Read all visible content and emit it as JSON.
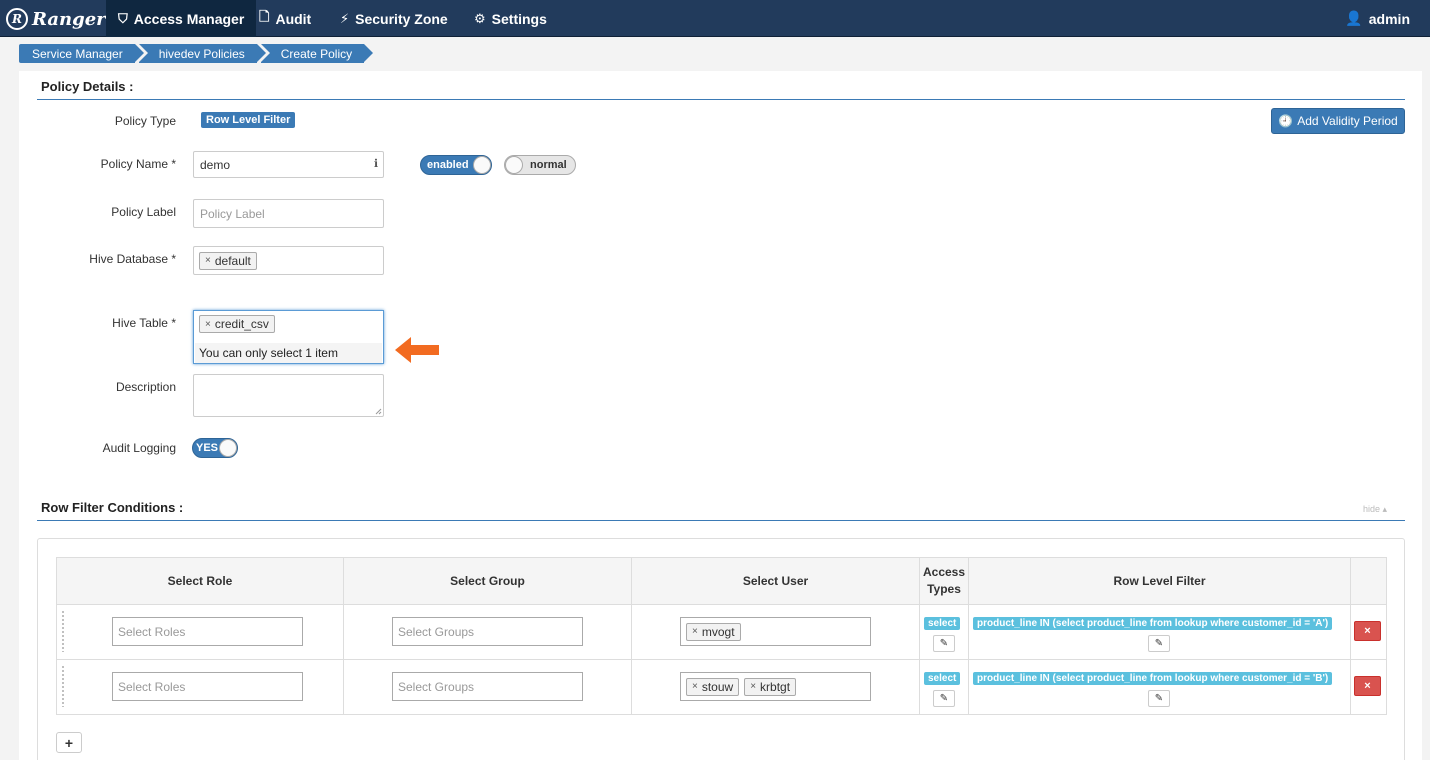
{
  "nav": {
    "brand": "Ranger",
    "brand_logo": "R",
    "items": [
      {
        "label": "Access Manager",
        "icon": "shield-icon",
        "glyph": "⛉"
      },
      {
        "label": "Audit",
        "icon": "file-icon",
        "glyph": "🗋"
      },
      {
        "label": "Security Zone",
        "icon": "lightning-icon",
        "glyph": "⚡"
      },
      {
        "label": "Settings",
        "icon": "gear-icon",
        "glyph": "⚙"
      }
    ],
    "user": "admin",
    "user_glyph": "👤"
  },
  "breadcrumb": [
    "Service Manager",
    "hivedev Policies",
    "Create Policy"
  ],
  "policy_details": {
    "title": "Policy Details :",
    "policy_type_label": "Policy Type",
    "policy_type_value": "Row Level Filter",
    "add_validity_label": "Add Validity Period",
    "add_validity_glyph": "🕘",
    "policy_name_label": "Policy Name *",
    "policy_name_value": "demo",
    "info_glyph": "ℹ",
    "enabled_toggle": "enabled",
    "normal_toggle": "normal",
    "policy_label_label": "Policy Label",
    "policy_label_placeholder": "Policy Label",
    "hive_database_label": "Hive Database *",
    "hive_database_tags": [
      "default"
    ],
    "hive_table_label": "Hive Table *",
    "hive_table_tags": [
      "credit_csv"
    ],
    "hive_table_message": "You can only select 1 item",
    "description_label": "Description",
    "audit_logging_label": "Audit Logging",
    "audit_logging_value": "YES",
    "tag_remove_glyph": "×"
  },
  "row_filter": {
    "title": "Row Filter Conditions :",
    "hide_link": "hide ▴",
    "headers": {
      "role": "Select Role",
      "group": "Select Group",
      "user": "Select User",
      "access": "Access Types",
      "filter": "Row Level Filter"
    },
    "rows": [
      {
        "role_placeholder": "Select Roles",
        "group_placeholder": "Select Groups",
        "users": [
          "mvogt"
        ],
        "access": "select",
        "filter": "product_line IN (select product_line from lookup where customer_id = 'A')"
      },
      {
        "role_placeholder": "Select Roles",
        "group_placeholder": "Select Groups",
        "users": [
          "stouw",
          "krbtgt"
        ],
        "access": "select",
        "filter": "product_line IN (select product_line from lookup where customer_id = 'B')"
      }
    ],
    "edit_glyph": "✎",
    "delete_glyph": "×",
    "add_glyph": "+"
  },
  "colors": {
    "navbar": "#223b5c",
    "primary": "#3b7ab5",
    "info": "#5bc0de",
    "danger": "#d9534f",
    "arrow": "#f26b21"
  }
}
